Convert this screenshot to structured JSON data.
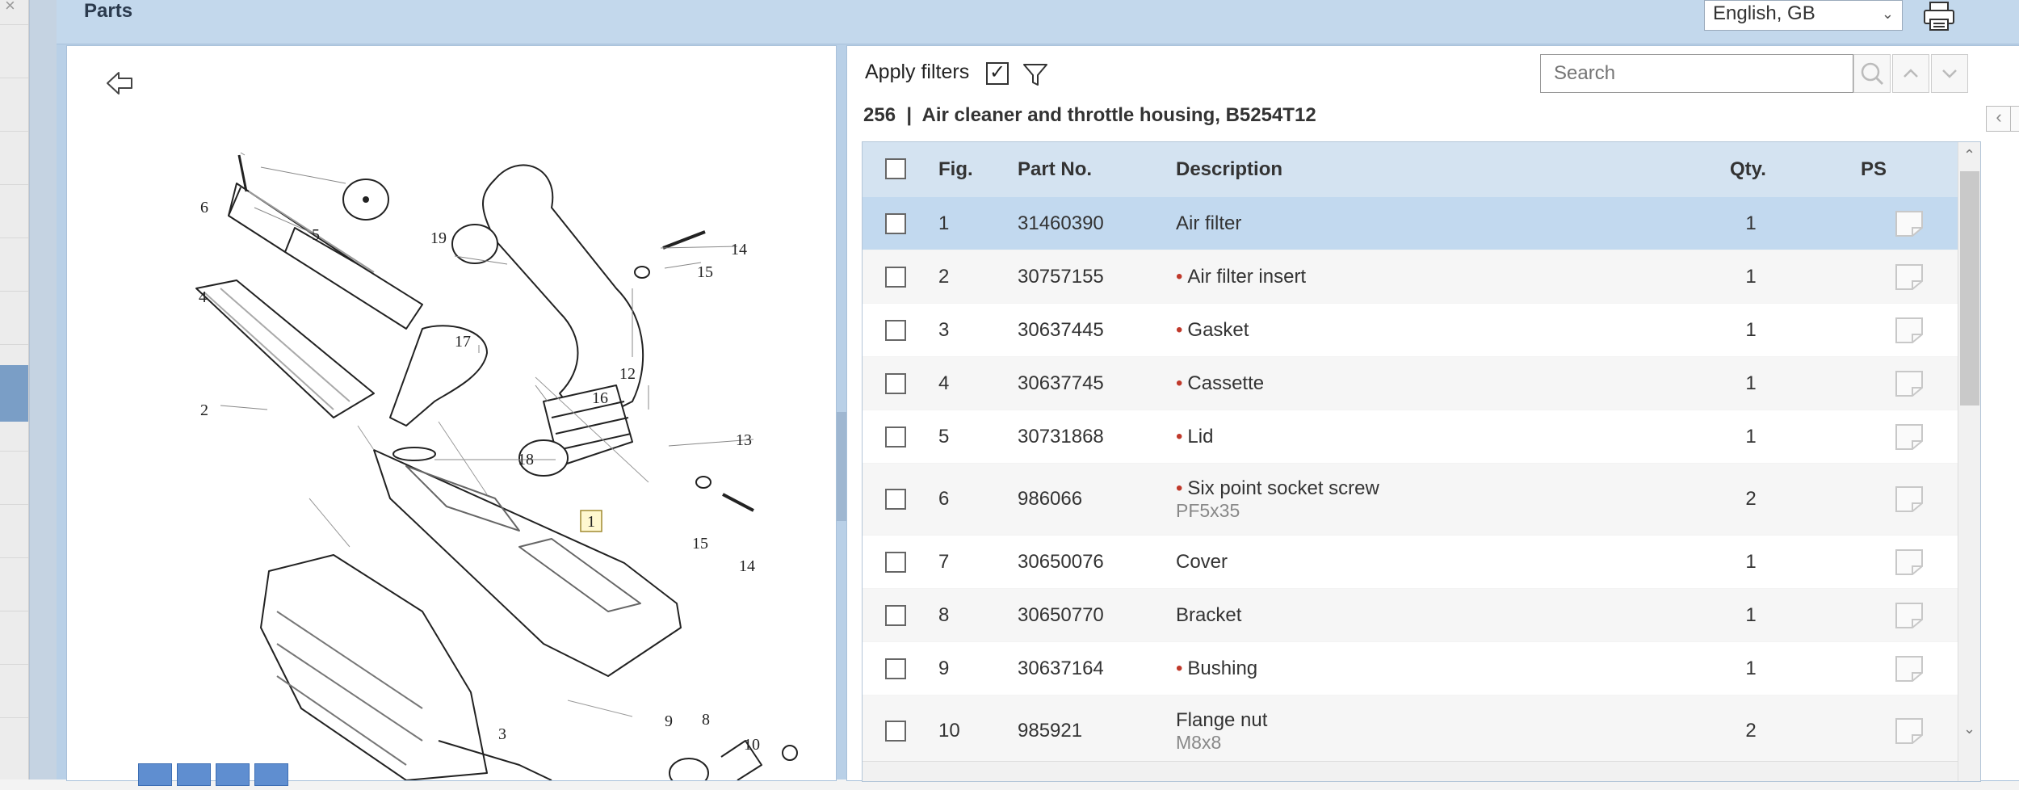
{
  "panel": {
    "title": "Parts"
  },
  "language": {
    "selected": "English, GB"
  },
  "filters": {
    "apply_label": "Apply filters",
    "apply_checked": true
  },
  "search": {
    "placeholder": "Search"
  },
  "group": {
    "title": "256  |  Air cleaner and throttle housing, B5254T12"
  },
  "table": {
    "headers": {
      "fig": "Fig.",
      "part": "Part No.",
      "desc": "Description",
      "qty": "Qty.",
      "ps": "PS"
    },
    "rows": [
      {
        "fig": "1",
        "part": "31460390",
        "desc": "Air filter",
        "bullet": false,
        "sub": "",
        "qty": "1",
        "selected": true
      },
      {
        "fig": "2",
        "part": "30757155",
        "desc": "Air filter insert",
        "bullet": true,
        "sub": "",
        "qty": "1"
      },
      {
        "fig": "3",
        "part": "30637445",
        "desc": "Gasket",
        "bullet": true,
        "sub": "",
        "qty": "1"
      },
      {
        "fig": "4",
        "part": "30637745",
        "desc": "Cassette",
        "bullet": true,
        "sub": "",
        "qty": "1"
      },
      {
        "fig": "5",
        "part": "30731868",
        "desc": "Lid",
        "bullet": true,
        "sub": "",
        "qty": "1"
      },
      {
        "fig": "6",
        "part": "986066",
        "desc": "Six point socket screw",
        "bullet": true,
        "sub": "PF5x35",
        "qty": "2"
      },
      {
        "fig": "7",
        "part": "30650076",
        "desc": "Cover",
        "bullet": false,
        "sub": "",
        "qty": "1"
      },
      {
        "fig": "8",
        "part": "30650770",
        "desc": "Bracket",
        "bullet": false,
        "sub": "",
        "qty": "1"
      },
      {
        "fig": "9",
        "part": "30637164",
        "desc": "Bushing",
        "bullet": true,
        "sub": "",
        "qty": "1"
      },
      {
        "fig": "10",
        "part": "985921",
        "desc": "Flange nut",
        "bullet": false,
        "sub": "M8x8",
        "qty": "2"
      }
    ]
  },
  "drawing": {
    "callouts": [
      "1",
      "2",
      "3",
      "4",
      "5",
      "6",
      "8",
      "9",
      "10",
      "12",
      "13",
      "14",
      "14",
      "15",
      "15",
      "16",
      "17",
      "18",
      "19"
    ]
  },
  "icons": {
    "back": "back-arrow-icon",
    "funnel": "funnel-icon",
    "print": "printer-icon",
    "search": "search-icon",
    "note": "note-icon"
  },
  "colors": {
    "selected_row": "#c2d9ef",
    "header_bg": "#c3d8ec",
    "bullet": "#c0392b"
  }
}
